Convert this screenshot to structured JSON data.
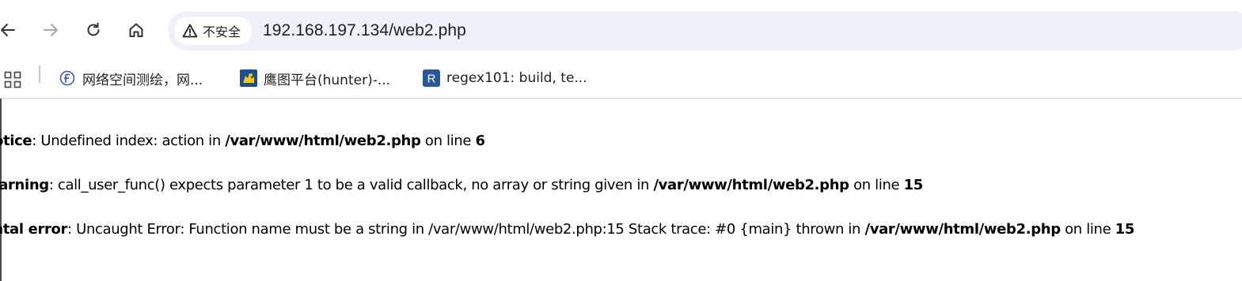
{
  "toolbar": {
    "security_label": "不安全",
    "url": "192.168.197.134/web2.php"
  },
  "bookmarks": [
    {
      "label": "网络空间测绘，网..."
    },
    {
      "label": "鹰图平台(hunter)-..."
    },
    {
      "label": "regex101: build, te..."
    }
  ],
  "errors": [
    {
      "type": "otice",
      "message": ": Undefined index: action in ",
      "file": "/var/www/html/web2.php",
      "on_line": " on line ",
      "line": "6"
    },
    {
      "type": "/arning",
      "message": ": call_user_func() expects parameter 1 to be a valid callback, no array or string given in ",
      "file": "/var/www/html/web2.php",
      "on_line": " on line ",
      "line": "15"
    },
    {
      "type": "atal error",
      "message": ": Uncaught Error: Function name must be a string in /var/www/html/web2.php:15 Stack trace: #0 {main} thrown in ",
      "file": "/var/www/html/web2.php",
      "on_line": " on line ",
      "line": "15"
    }
  ],
  "colors": {
    "omnibox_bg": "#eef1f9",
    "regex_favicon": "#2b5797",
    "hunter_favicon": "#1d4e8f"
  }
}
